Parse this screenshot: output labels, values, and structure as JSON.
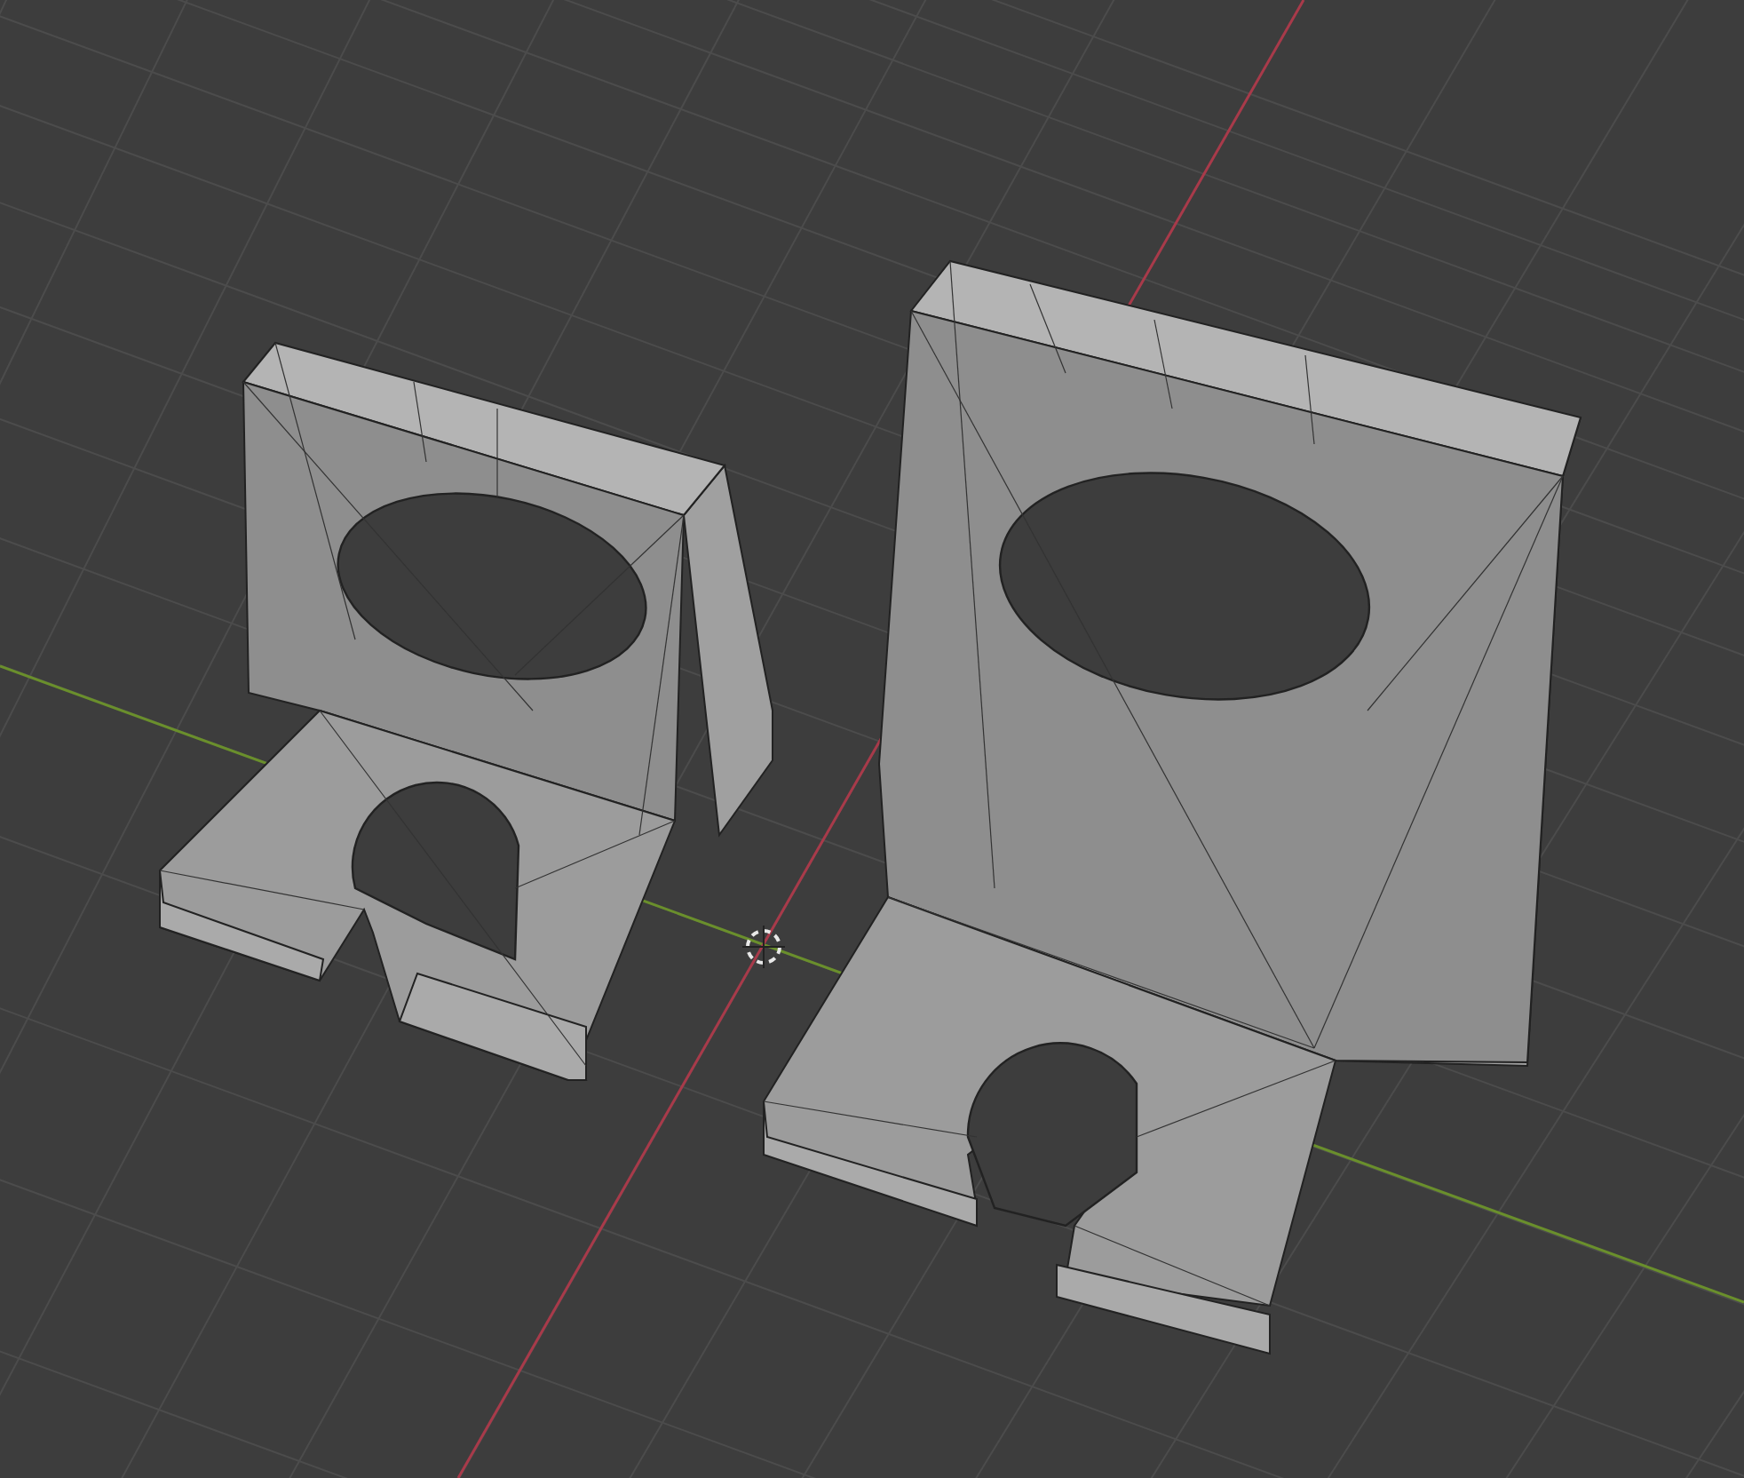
{
  "viewport": {
    "show_axes": true,
    "show_cursor": true
  }
}
